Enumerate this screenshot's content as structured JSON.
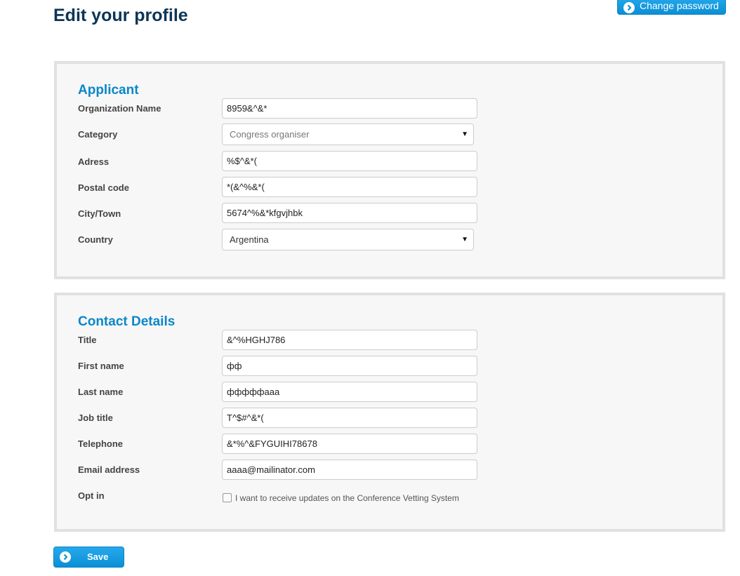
{
  "page": {
    "title": "Edit your profile",
    "change_password_label": "Change password",
    "save_label": "Save"
  },
  "applicant": {
    "heading": "Applicant",
    "fields": {
      "organization_name": {
        "label": "Organization Name",
        "value": "8959&^&*"
      },
      "category": {
        "label": "Category",
        "value": "Congress organiser"
      },
      "address": {
        "label": "Adress",
        "value": "%$^&*("
      },
      "postal_code": {
        "label": "Postal code",
        "value": "*(&^%&*("
      },
      "city": {
        "label": "City/Town",
        "value": "5674^%&*kfgvjhbk"
      },
      "country": {
        "label": "Country",
        "value": "Argentina"
      }
    }
  },
  "contact": {
    "heading": "Contact Details",
    "fields": {
      "title": {
        "label": "Title",
        "value": "&^%HGHJ786"
      },
      "first_name": {
        "label": "First name",
        "value": "фф"
      },
      "last_name": {
        "label": "Last name",
        "value": "фффффааа"
      },
      "job_title": {
        "label": "Job title",
        "value": "T^$#^&*("
      },
      "telephone": {
        "label": "Telephone",
        "value": "&*%^&FYGUIHI78678"
      },
      "email": {
        "label": "Email address",
        "value": "aaaa@mailinator.com"
      },
      "opt_in": {
        "label": "Opt in",
        "checkbox_text": "I want to receive updates on the Conference Vetting System",
        "checked": false
      }
    }
  },
  "icons": {
    "button_icon": "chevron-right-circle-icon",
    "select_icon": "dropdown-arrow-icon"
  },
  "colors": {
    "title": "#0d3556",
    "section_heading": "#0a87c9",
    "button": "#0a8fd6",
    "panel_border": "#e1e1e1",
    "panel_background": "#f7f7f7"
  }
}
